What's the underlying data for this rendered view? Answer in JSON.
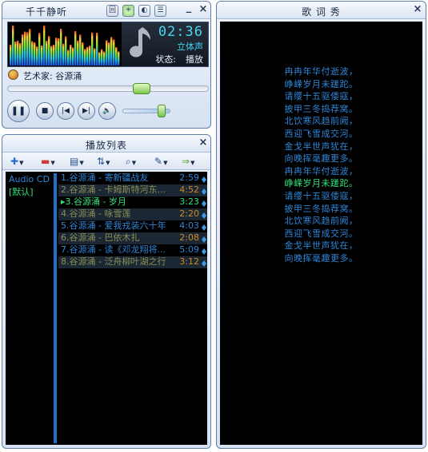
{
  "main": {
    "title": "千千静听",
    "title_buttons": [
      "回",
      "✳",
      "◐",
      "☰"
    ],
    "minimize": "_",
    "close": "×",
    "time": "02:36",
    "channel": "立体声",
    "status_label": "状态:",
    "status_value": "播放",
    "artist_label": "艺术家:",
    "artist_value": "谷源涌",
    "seek_position": 0.68,
    "volume_level": 0.85,
    "controls": [
      "pause",
      "stop",
      "previous",
      "next",
      "mute"
    ]
  },
  "playlist": {
    "title": "播放列表",
    "close": "×",
    "lists": [
      {
        "name": "Audio CD",
        "color": "#2f86d8"
      },
      {
        "name": "[默认]",
        "color": "#34e07a"
      }
    ],
    "tracks": [
      {
        "name": "1.谷源涌 - 寄新疆战友",
        "duration": "2:59",
        "state": "normal"
      },
      {
        "name": "2.谷源涌 - 卡姆斯特河东...",
        "duration": "4:52",
        "state": "played"
      },
      {
        "name": "3.谷源涌 - 岁月",
        "duration": "3:23",
        "state": "playing"
      },
      {
        "name": "4.谷源涌 - 咏雪莲",
        "duration": "2:20",
        "state": "played"
      },
      {
        "name": "5.谷源涌 - 爱我戎装六十年",
        "duration": "4:03",
        "state": "normal"
      },
      {
        "name": "6.谷源涌 - 巴依木扎",
        "duration": "2:08",
        "state": "played"
      },
      {
        "name": "7.谷源涌 - 读《邓龙翔将...",
        "duration": "5:09",
        "state": "normal"
      },
      {
        "name": "8.谷源涌 - 泛舟柳叶湖之行",
        "duration": "3:12",
        "state": "played"
      }
    ],
    "colors": {
      "normal": "#2f86d8",
      "played": "#8a8f55",
      "playing": "#34e07a",
      "played_duration": "#d08a2a"
    }
  },
  "lyrics": {
    "title": "歌 词 秀",
    "close": "×",
    "current_line": 9,
    "lines": [
      "冉冉年华付逝波，",
      "峥嵘岁月未蹉跎。",
      "请缨十五驱倭寇，",
      "披甲三冬捣荐窝。",
      "北饮寒风趋前阙，",
      "西迎飞雪成交河。",
      "金戈半世声犹在，",
      "向晚挥毫趣更多。",
      "冉冉年华付逝波，",
      "峥嵘岁月未蹉跎。",
      "请缨十五驱倭寇，",
      "披甲三冬捣荐窝。",
      "北饮寒风趋前阙，",
      "西迎飞雪成交河。",
      "金戈半世声犹在，",
      "向晚挥毫趣更多。"
    ]
  }
}
